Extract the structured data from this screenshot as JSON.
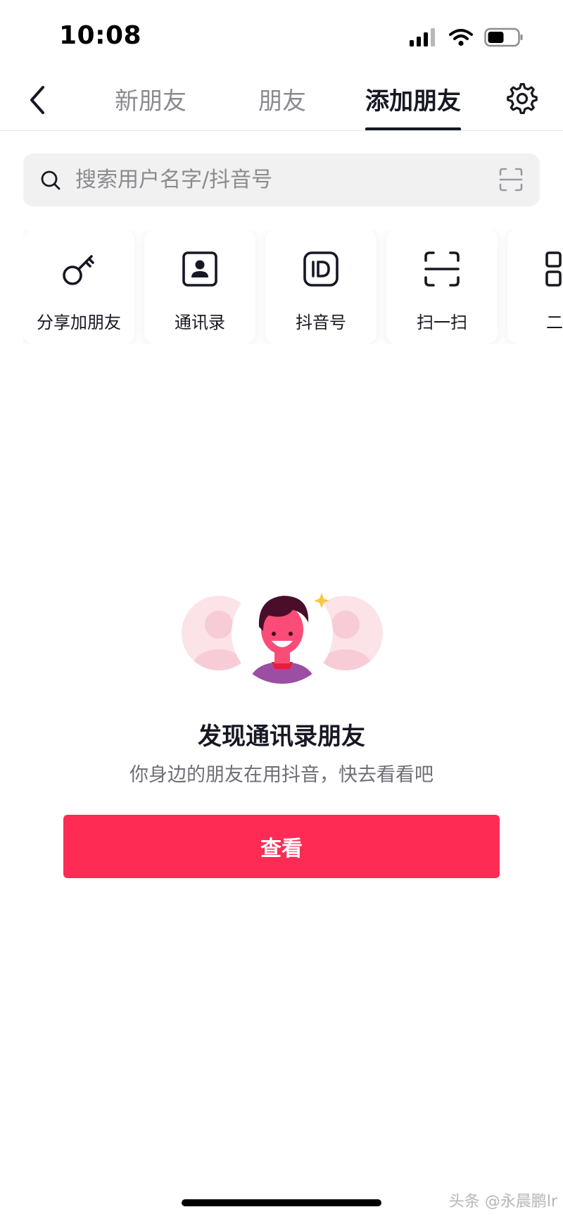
{
  "status_bar": {
    "time": "10:08",
    "icons": [
      "signal-icon",
      "wifi-icon",
      "battery-icon"
    ]
  },
  "nav": {
    "tabs": [
      {
        "label": "新朋友",
        "active": false
      },
      {
        "label": "朋友",
        "active": false
      },
      {
        "label": "添加朋友",
        "active": true
      }
    ],
    "back_icon": "chevron-left-icon",
    "settings_icon": "gear-icon"
  },
  "search": {
    "placeholder": "搜索用户名字/抖音号",
    "value": "",
    "left_icon": "search-icon",
    "right_icon": "scan-icon"
  },
  "options": [
    {
      "label": "分享加朋友",
      "icon": "key-icon"
    },
    {
      "label": "通讯录",
      "icon": "contact-book-icon"
    },
    {
      "label": "抖音号",
      "icon": "id-icon"
    },
    {
      "label": "扫一扫",
      "icon": "scan-icon"
    },
    {
      "label": "二维",
      "icon": "qr-code-icon"
    }
  ],
  "empty_state": {
    "title": "发现通讯录朋友",
    "subtitle": "你身边的朋友在用抖音，快去看看吧",
    "button_label": "查看"
  },
  "watermark": "头条 @永晨鹏lr",
  "colors": {
    "accent": "#fe2c55",
    "text_primary": "#161823",
    "text_secondary": "#8a8b91",
    "search_bg": "#f1f1f2"
  }
}
